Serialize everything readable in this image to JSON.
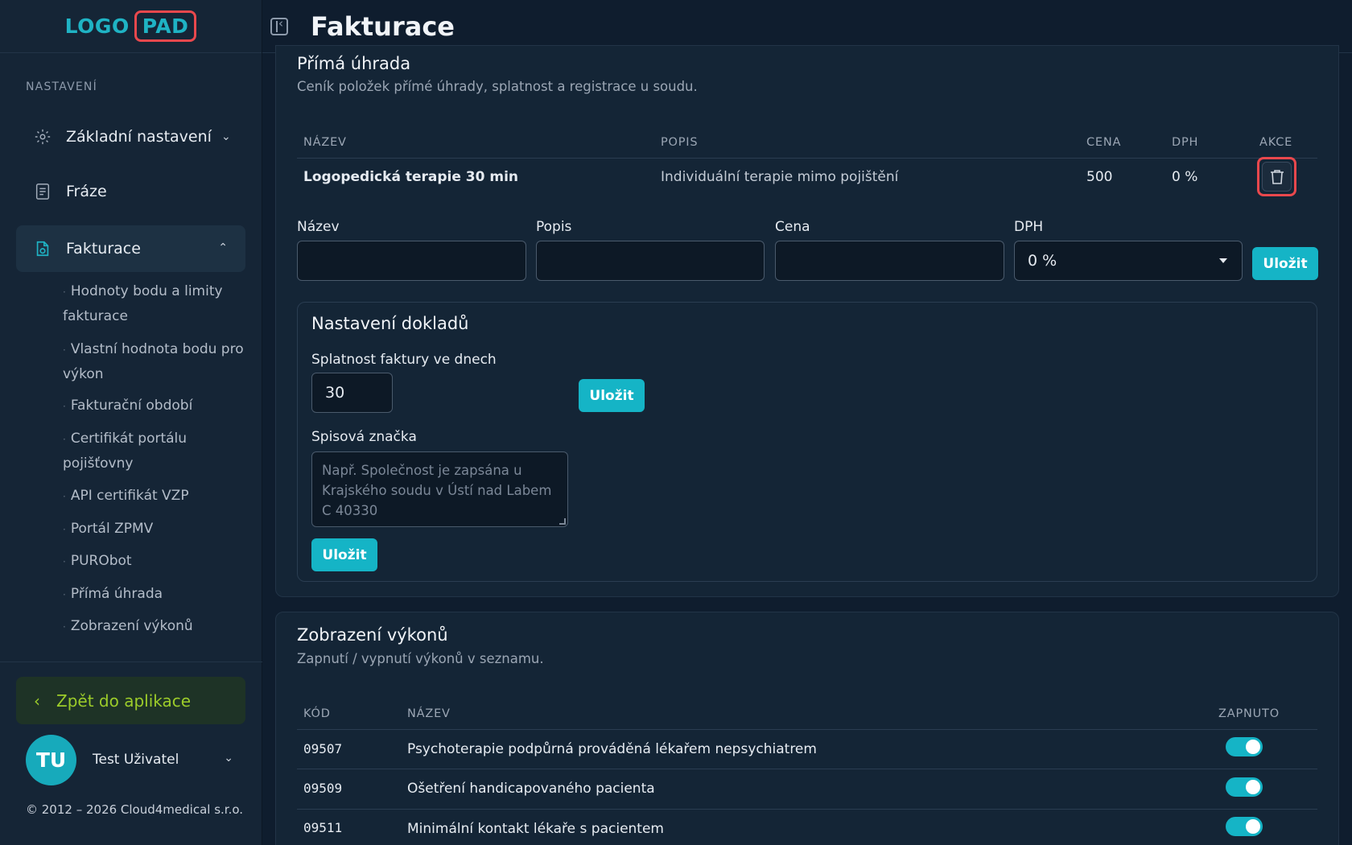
{
  "logo": {
    "part1": "LOGO",
    "part2": "PAD"
  },
  "sidebar": {
    "section_label": "NASTAVENÍ",
    "items": [
      {
        "label": "Základní nastavení",
        "icon": "gear-icon"
      },
      {
        "label": "Fráze",
        "icon": "document-icon"
      },
      {
        "label": "Fakturace",
        "icon": "invoice-icon"
      }
    ],
    "subitems": [
      "Hodnoty bodu a limity fakturace",
      "Vlastní hodnota bodu pro výkon",
      "Fakturační období",
      "Certifikát portálu pojišťovny",
      "API certifikát VZP",
      "Portál ZPMV",
      "PURObot",
      "Přímá úhrada",
      "Zobrazení výkonů"
    ],
    "back_label": "Zpět do aplikace",
    "user": {
      "initials": "TU",
      "name": "Test Uživatel"
    },
    "copyright": "© 2012 – 2026 Cloud4medical s.r.o."
  },
  "header": {
    "title": "Fakturace"
  },
  "direct_payment": {
    "title": "Přímá úhrada",
    "subtitle": "Ceník položek přímé úhrady, splatnost a registrace u soudu.",
    "columns": [
      "NÁZEV",
      "POPIS",
      "CENA",
      "DPH",
      "AKCE"
    ],
    "rows": [
      {
        "name": "Logopedická terapie 30 min",
        "description": "Individuální terapie mimo pojištění",
        "price": "500",
        "vat": "0 %"
      }
    ],
    "form": {
      "name_label": "Název",
      "desc_label": "Popis",
      "price_label": "Cena",
      "vat_label": "DPH",
      "vat_value": "0 %",
      "save_label": "Uložit"
    },
    "doc_settings": {
      "title": "Nastavení dokladů",
      "due_label": "Splatnost faktury ve dnech",
      "due_value": "30",
      "save_label": "Uložit",
      "file_label": "Spisová značka",
      "file_placeholder": "Např. Společnost je zapsána u Krajského soudu v Ústí nad Labem C 40330",
      "save2_label": "Uložit"
    }
  },
  "procedures": {
    "title": "Zobrazení výkonů",
    "subtitle": "Zapnutí / vypnutí výkonů v seznamu.",
    "columns": [
      "KÓD",
      "NÁZEV",
      "ZAPNUTO"
    ],
    "rows": [
      {
        "code": "09507",
        "name": "Psychoterapie podpůrná prováděná lékařem nepsychiatrem",
        "enabled": true
      },
      {
        "code": "09509",
        "name": "Ošetření handicapovaného pacienta",
        "enabled": true
      },
      {
        "code": "09511",
        "name": "Minimální kontakt lékaře s pacientem",
        "enabled": true
      }
    ]
  },
  "colors": {
    "accent": "#15b4c6",
    "highlight": "#e9484d",
    "back": "#9ccc2a"
  }
}
